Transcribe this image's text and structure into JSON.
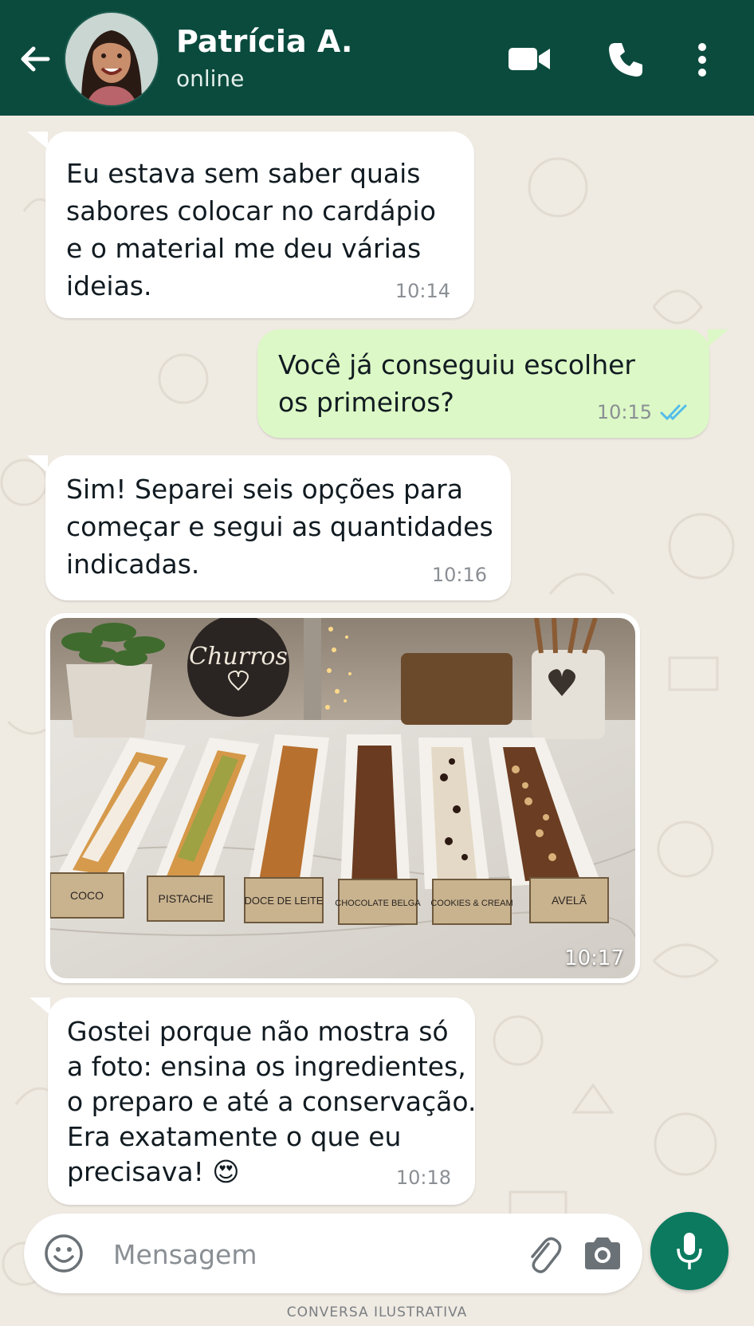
{
  "header": {
    "contact_name": "Patrícia A.",
    "contact_status": "online",
    "background_color": "#0b4b3e"
  },
  "icons": {
    "back": "arrow-left",
    "video": "video-camera",
    "call": "phone",
    "menu": "more-vertical",
    "emoji": "smiley",
    "attach": "paperclip",
    "camera": "camera",
    "mic": "microphone",
    "read_receipt": "double-check"
  },
  "messages": [
    {
      "direction": "incoming",
      "lines": [
        "Eu estava sem saber quais",
        "sabores colocar no cardápio",
        "e o material me deu várias",
        "ideias."
      ],
      "time": "10:14"
    },
    {
      "direction": "outgoing",
      "lines": [
        "Você já conseguiu escolher",
        "os primeiros?"
      ],
      "time": "10:15",
      "read": true
    },
    {
      "direction": "incoming",
      "lines": [
        "Sim! Separei seis opções para",
        "começar e segui as quantidades",
        "indicadas."
      ],
      "time": "10:16"
    },
    {
      "direction": "incoming",
      "type": "image",
      "time": "10:17",
      "photo": {
        "sign_text": "Churros",
        "labels": [
          "COCO",
          "PISTACHE",
          "DOCE DE LEITE",
          "CHOCOLATE BELGA",
          "COOKIES & CREAM",
          "AVELÃ"
        ]
      }
    },
    {
      "direction": "incoming",
      "lines": [
        "Gostei porque não mostra só",
        "a foto: ensina os ingredientes,",
        "o preparo e até a conservação.",
        "Era exatamente o que eu",
        "precisava! 😍"
      ],
      "time": "10:18"
    }
  ],
  "composer": {
    "placeholder": "Mensagem"
  },
  "footer_note": "CONVERSA ILUSTRATIVA",
  "colors": {
    "chat_background": "#efeae2",
    "incoming_bubble": "#ffffff",
    "outgoing_bubble": "#dcf8c6",
    "accent": "#0b7a5f",
    "read_tick": "#53bdeb"
  }
}
